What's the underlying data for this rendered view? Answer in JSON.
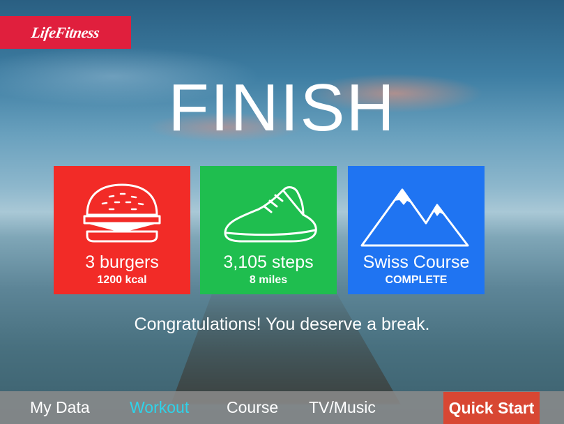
{
  "brand": {
    "logo_text": "LifeFitness",
    "color": "#e01f3d"
  },
  "heading": "FINISH",
  "tiles": [
    {
      "icon": "burger-icon",
      "main": "3 burgers",
      "sub": "1200 kcal",
      "color": "#f22b27"
    },
    {
      "icon": "sneaker-icon",
      "main": "3,105 steps",
      "sub": "8 miles",
      "color": "#1fbe4f"
    },
    {
      "icon": "mountain-icon",
      "main": "Swiss Course",
      "sub": "COMPLETE",
      "color": "#1f74f2"
    }
  ],
  "message": "Congratulations! You deserve a break.",
  "nav": {
    "items": [
      {
        "label": "My Data",
        "active": false
      },
      {
        "label": "Workout",
        "active": true
      },
      {
        "label": "Course",
        "active": false
      },
      {
        "label": "TV/Music",
        "active": false
      }
    ],
    "quick_start": "Quick Start",
    "active_color": "#2ed3ea",
    "quick_start_color": "#d84733"
  }
}
